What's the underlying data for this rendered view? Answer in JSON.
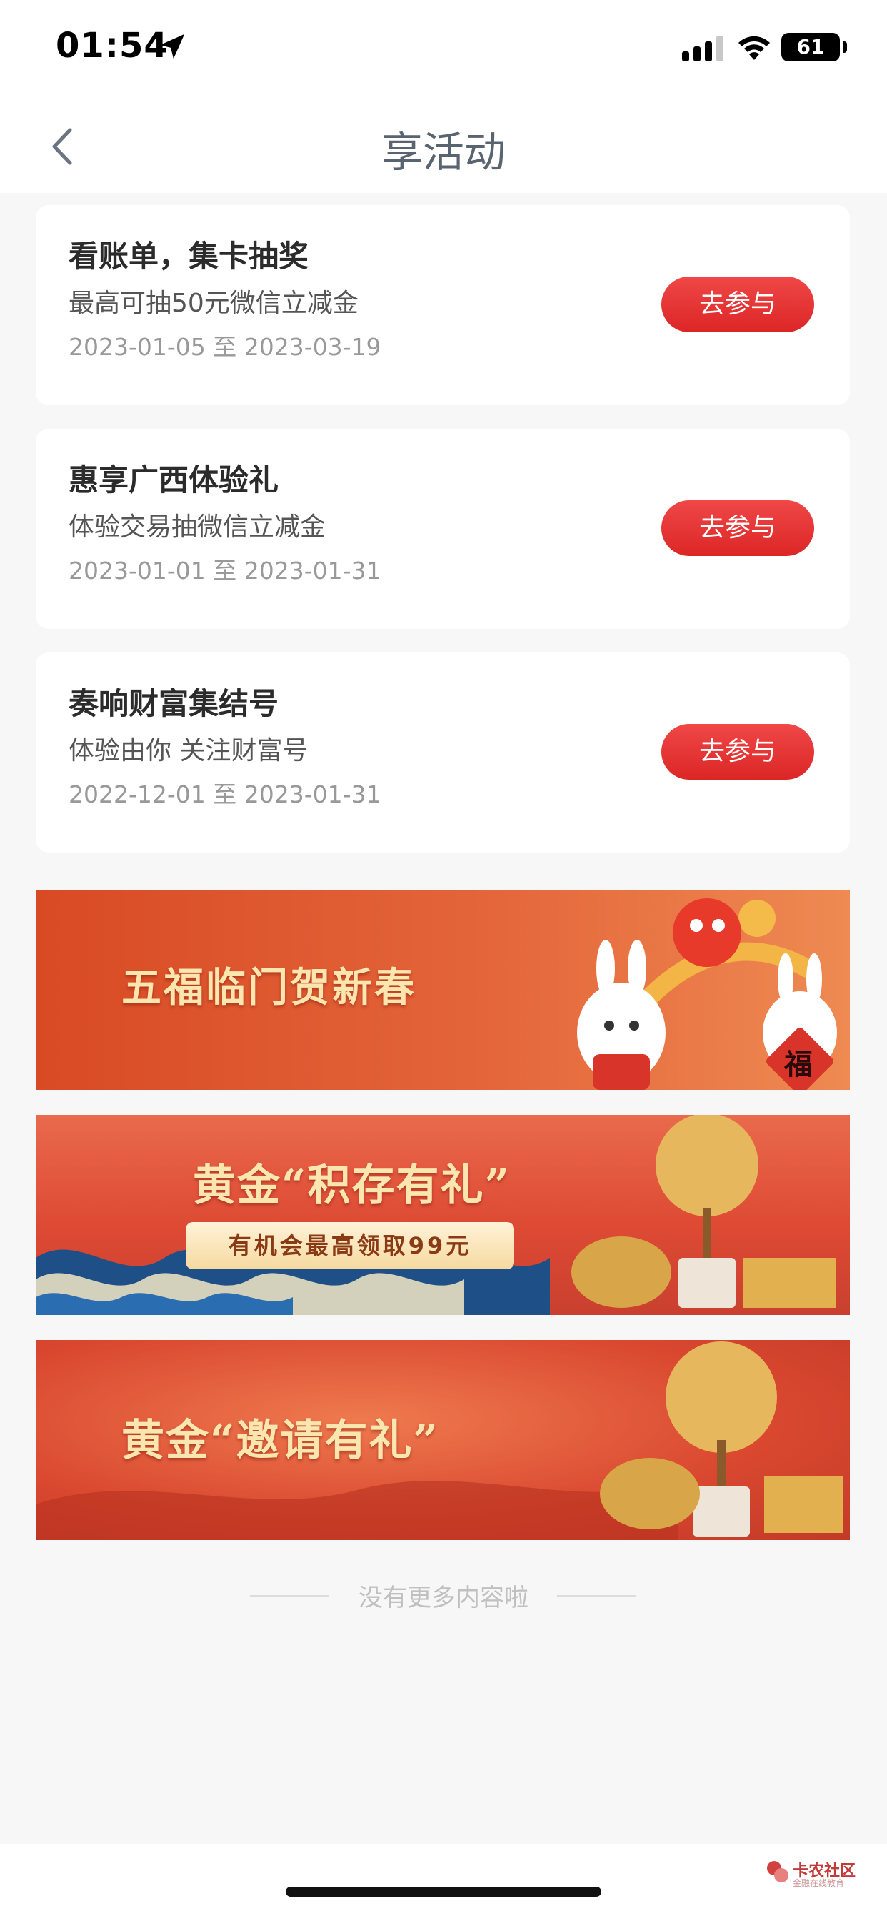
{
  "status_bar": {
    "time": "01:54",
    "battery": "61"
  },
  "nav": {
    "title": "享活动"
  },
  "activities": [
    {
      "title": "看账单，集卡抽奖",
      "subtitle": "最高可抽50元微信立减金",
      "date_range": "2023-01-05 至 2023-03-19",
      "button": "去参与"
    },
    {
      "title": "惠享广西体验礼",
      "subtitle": "体验交易抽微信立减金",
      "date_range": "2023-01-01 至 2023-01-31",
      "button": "去参与"
    },
    {
      "title": "奏响财富集结号",
      "subtitle": "体验由你 关注财富号",
      "date_range": "2022-12-01 至 2023-01-31",
      "button": "去参与"
    }
  ],
  "banners": [
    {
      "headline": "五福临门贺新春",
      "badge": "福"
    },
    {
      "headline": "黄金“积存有礼”",
      "sub": "有机会最高领取99元"
    },
    {
      "headline": "黄金“邀请有礼”"
    }
  ],
  "footer": {
    "end_text": "没有更多内容啦"
  },
  "watermark": {
    "name": "卡农社区",
    "sub": "金融在线教育"
  }
}
